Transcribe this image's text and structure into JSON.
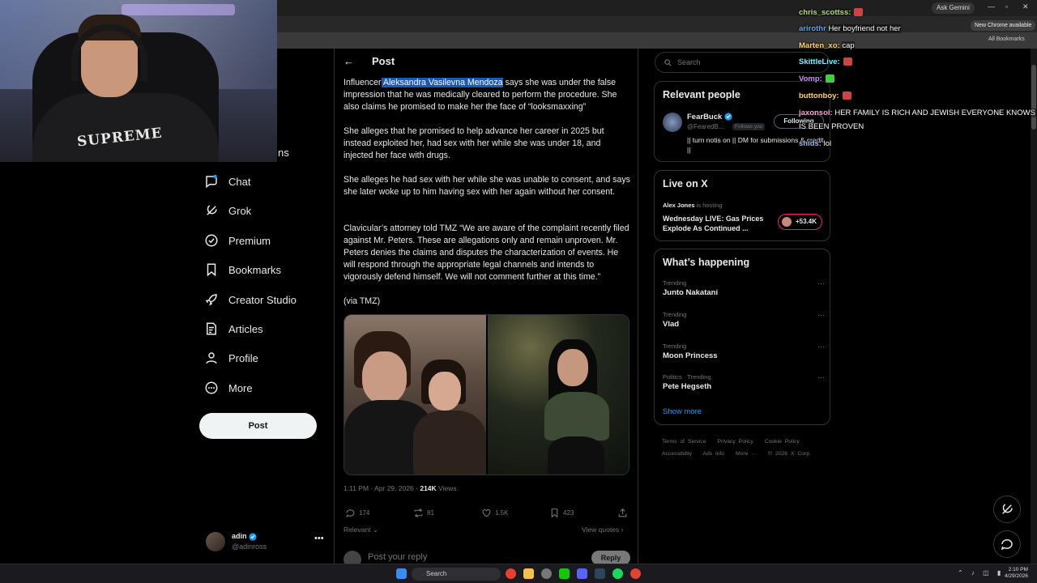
{
  "browser": {
    "ask_gemini": "Ask Gemini",
    "new_chrome": "New Chrome available",
    "all_bookmarks": "All Bookmarks"
  },
  "webcam": {
    "shirt_text": "SUPREME"
  },
  "nav": {
    "partial_label": "ns",
    "items": [
      {
        "label": "Chat"
      },
      {
        "label": "Grok"
      },
      {
        "label": "Premium"
      },
      {
        "label": "Bookmarks"
      },
      {
        "label": "Creator Studio"
      },
      {
        "label": "Articles"
      },
      {
        "label": "Profile"
      },
      {
        "label": "More"
      }
    ],
    "post_button": "Post"
  },
  "account": {
    "name": "adin",
    "handle": "@adinross"
  },
  "post": {
    "header_title": "Post",
    "p1_prefix": "Influencer",
    "p1_highlight": " Aleksandra Vasilevna Mendoza",
    "p1_rest": " says she was under the false impression that he was medically cleared to perform the procedure. She also claims he promised to make her the face of “looksmaxxing”",
    "p2": "She alleges that he promised to help advance her career in 2025 but instead exploited her, had sex with her while she was under 18, and injected her face with drugs.",
    "p3": "She alleges he had sex with her while she was unable to consent, and says she later woke up to him having sex with her again without her consent.",
    "p4": "Clavicular’s attorney told TMZ “We are aware of the complaint recently filed against Mr. Peters. These are allegations only and remain unproven. Mr. Peters denies the claims and disputes the characterization of events. He will respond through the appropriate legal channels and intends to vigorously defend himself. We will not comment further at this time.”",
    "p5": "(via TMZ)",
    "timestamp": "1:11 PM · Apr 29, 2026 · ",
    "views_count": "214K",
    "views_label": " Views",
    "replies": "174",
    "reposts": "81",
    "likes": "1.5K",
    "bookmarks": "423",
    "relevant": "Relevant ⌄",
    "view_quotes": "View quotes ›",
    "reply_placeholder": "Post your reply",
    "reply_button": "Reply"
  },
  "sidebar": {
    "search_placeholder": "Search",
    "relevant_title": "Relevant people",
    "person": {
      "name": "FearBuck",
      "handle": "@FearedB...",
      "follows_you": "Follows you",
      "following": "Following",
      "bio": "|| turn notis on || DM for submissions & credit ||"
    },
    "live_title": "Live on X",
    "live": {
      "host": "Alex Jones",
      "hosting": " is hosting",
      "title": "Wednesday LIVE: Gas Prices Explode As Continued ...",
      "listeners": "+53.4K"
    },
    "happening_title": "What’s happening",
    "trends": [
      {
        "context": "Trending",
        "name": "Junto Nakatani"
      },
      {
        "context": "Trending",
        "name": "Vlad"
      },
      {
        "context": "Trending",
        "name": "Moon Princess"
      },
      {
        "context": "Politics · Trending",
        "name": "Pete Hegseth"
      }
    ],
    "show_more": "Show more",
    "footer": [
      "Terms of Service",
      "Privacy Policy",
      "Cookie Policy",
      "Accessibility",
      "Ads info",
      "More ···",
      "© 2026 X Corp."
    ]
  },
  "stream_chat": [
    {
      "user": "chris_scottss:",
      "msg": "",
      "color": "#b4e060"
    },
    {
      "user": "arirothr",
      "msg": "Her boyfriend not her",
      "color": "#5aa6ff"
    },
    {
      "user": "Marten_xo:",
      "msg": "cap",
      "color": "#ffd27a"
    },
    {
      "user": "SkittleLive:",
      "msg": "",
      "color": "#7df3ff"
    },
    {
      "user": "Vomp:",
      "msg": "",
      "color": "#d08cff"
    },
    {
      "user": "buttonboy:",
      "msg": "",
      "color": "#ffd27a"
    },
    {
      "user": "jaxonsol:",
      "msg": "HER FAMILY IS RICH AND JEWISH EVERYONE KNOWS IT",
      "color": "#ff9fd6"
    },
    {
      "user": "",
      "msg": "IS BEEN PROVEN",
      "color": "#ffffff"
    },
    {
      "user": "shids:",
      "msg": "lol",
      "color": "#9db7ff"
    }
  ],
  "taskbar": {
    "search": "Search",
    "time": "2:10 PM",
    "date": "4/29/2026"
  }
}
